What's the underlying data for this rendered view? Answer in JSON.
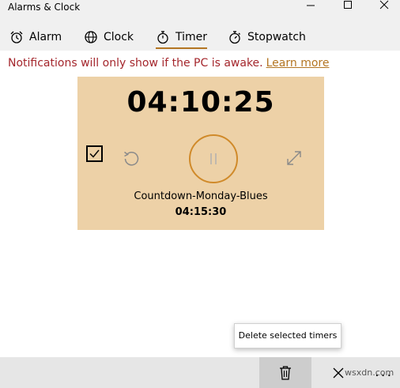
{
  "window": {
    "title": "Alarms & Clock",
    "controls": [
      "minimize-icon",
      "maximize-icon",
      "close-icon"
    ]
  },
  "nav": {
    "tabs": [
      {
        "label": "Alarm",
        "icon": "alarm-icon"
      },
      {
        "label": "Clock",
        "icon": "globe-icon"
      },
      {
        "label": "Timer",
        "icon": "timer-icon",
        "active": true
      },
      {
        "label": "Stopwatch",
        "icon": "stopwatch-icon"
      }
    ]
  },
  "notice": {
    "text": "Notifications will only show if the PC is awake.",
    "link": "Learn more"
  },
  "timer": {
    "remaining": "04:10:25",
    "name": "Countdown-Monday-Blues",
    "duration": "04:15:30",
    "selected": true,
    "state": "running"
  },
  "tooltip": {
    "text": "Delete selected timers"
  },
  "commandbar": {
    "items": [
      "trash-icon",
      "cancel-icon",
      "more-icon"
    ],
    "more_label": "..."
  },
  "watermark": "wsxdn.com",
  "colors": {
    "accent": "#b37522",
    "warning": "#a4262c",
    "card": "#edd1a7",
    "chrome": "#f0f0f0",
    "commandbar": "#e6e6e6"
  }
}
